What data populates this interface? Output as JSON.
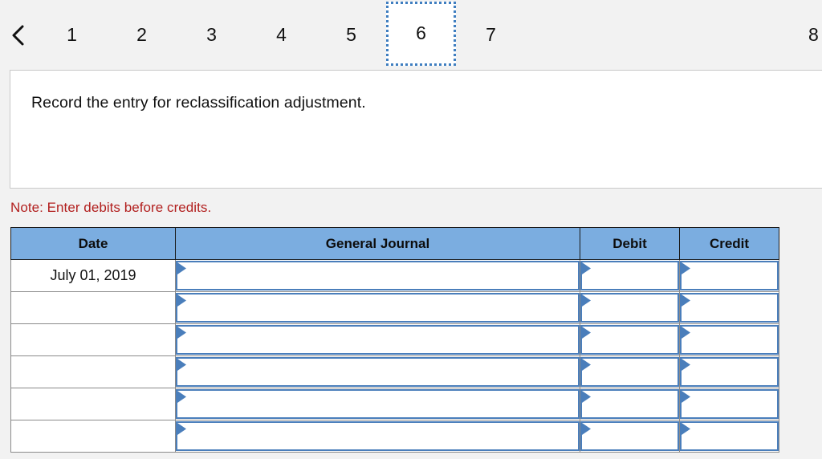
{
  "tabbar": {
    "back_icon": "chevron-left-icon",
    "tabs": [
      {
        "label": "1",
        "selected": false
      },
      {
        "label": "2",
        "selected": false
      },
      {
        "label": "3",
        "selected": false
      },
      {
        "label": "4",
        "selected": false
      },
      {
        "label": "5",
        "selected": false
      },
      {
        "label": "6",
        "selected": true
      },
      {
        "label": "7",
        "selected": false
      }
    ],
    "overflow_label": "8",
    "selected_tab": "6"
  },
  "panel": {
    "instruction": "Record the entry for reclassification adjustment."
  },
  "note": {
    "text": "Note: Enter debits before credits.",
    "color": "#b2201f"
  },
  "journal": {
    "accent_header_color": "#7bade0",
    "field_border_color": "#4a7ebb",
    "columns": [
      "Date",
      "General Journal",
      "Debit",
      "Credit"
    ],
    "rows": [
      {
        "date": "July 01, 2019",
        "general_journal": "",
        "debit": "",
        "credit": ""
      },
      {
        "date": "",
        "general_journal": "",
        "debit": "",
        "credit": ""
      },
      {
        "date": "",
        "general_journal": "",
        "debit": "",
        "credit": ""
      },
      {
        "date": "",
        "general_journal": "",
        "debit": "",
        "credit": ""
      },
      {
        "date": "",
        "general_journal": "",
        "debit": "",
        "credit": ""
      },
      {
        "date": "",
        "general_journal": "",
        "debit": "",
        "credit": ""
      }
    ]
  }
}
